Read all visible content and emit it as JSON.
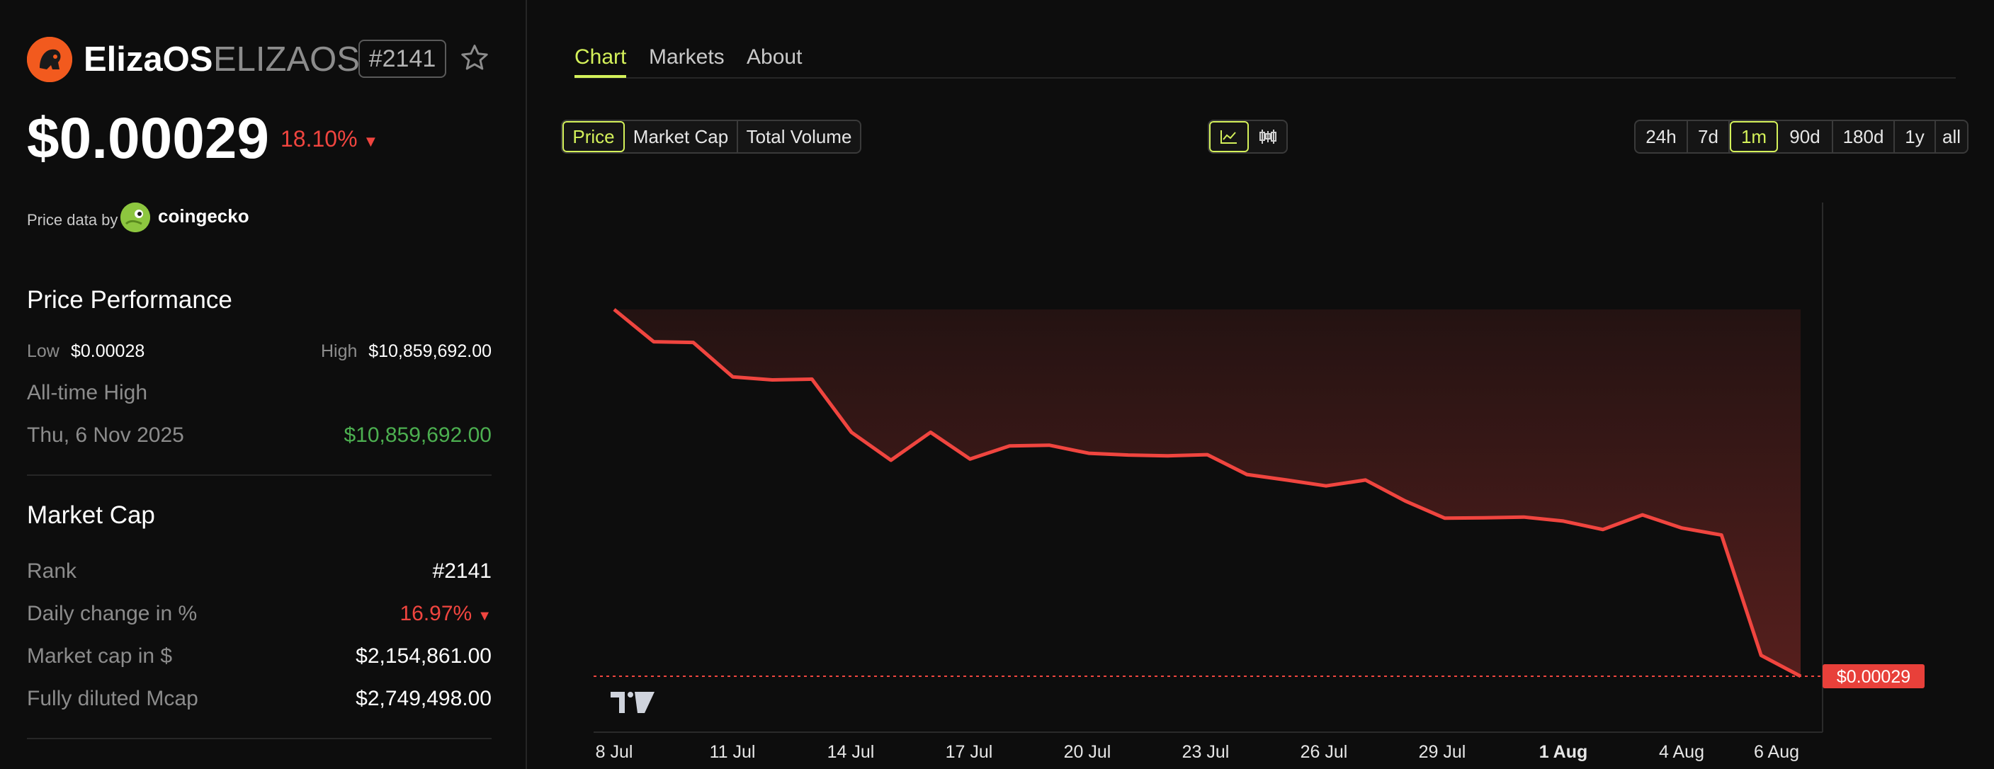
{
  "token": {
    "name": "ElizaOS",
    "ticker": "ELIZAOS",
    "rank_badge": "#2141",
    "price": "$0.00029",
    "change_24h": "18.10%",
    "change_direction": "down"
  },
  "price_data": {
    "label": "Price data by",
    "provider": "coingecko"
  },
  "performance": {
    "title": "Price Performance",
    "low_label": "Low",
    "low_value": "$0.00028",
    "high_label": "High",
    "high_value": "$10,859,692.00",
    "ath_label": "All-time High",
    "ath_date": "Thu, 6 Nov 2025",
    "ath_value": "$10,859,692.00"
  },
  "market_cap": {
    "title": "Market Cap",
    "rows": [
      {
        "label": "Rank",
        "value": "#2141"
      },
      {
        "label": "Daily change in %",
        "value": "16.97%"
      },
      {
        "label": "Market cap in $",
        "value": "$2,154,861.00"
      },
      {
        "label": "Fully diluted Mcap",
        "value": "$2,749,498.00"
      }
    ]
  },
  "tabs": [
    "Chart",
    "Markets",
    "About"
  ],
  "active_tab": "Chart",
  "metrics": [
    "Price",
    "Market Cap",
    "Total Volume"
  ],
  "active_metric": "Price",
  "chart_modes": [
    "line-chart-icon",
    "candlestick-icon"
  ],
  "ranges": [
    "24h",
    "7d",
    "1m",
    "90d",
    "180d",
    "1y",
    "all"
  ],
  "active_range": "1m",
  "colors": {
    "accent": "#d4f15a",
    "negative": "#f0453f",
    "positive": "#4caf50",
    "background": "#0d0d0d"
  },
  "chart_data": {
    "type": "area",
    "series": [
      {
        "values": [
          1.0,
          0.912,
          0.91,
          0.816,
          0.808,
          0.81,
          0.665,
          0.589,
          0.665,
          0.592,
          0.628,
          0.63,
          0.608,
          0.603,
          0.601,
          0.604,
          0.55,
          0.535,
          0.519,
          0.535,
          0.478,
          0.431,
          0.432,
          0.434,
          0.423,
          0.4,
          0.44,
          0.404,
          0.385,
          0.057,
          0.0
        ]
      }
    ],
    "x_ticks": [
      "8 Jul",
      "11 Jul",
      "14 Jul",
      "17 Jul",
      "20 Jul",
      "23 Jul",
      "26 Jul",
      "29 Jul",
      "1 Aug",
      "4 Aug",
      "6 Aug"
    ],
    "bold_tick": "1 Aug",
    "last_price_label": "$0.00029",
    "y_axis_labels_visible": false,
    "grid": false
  }
}
